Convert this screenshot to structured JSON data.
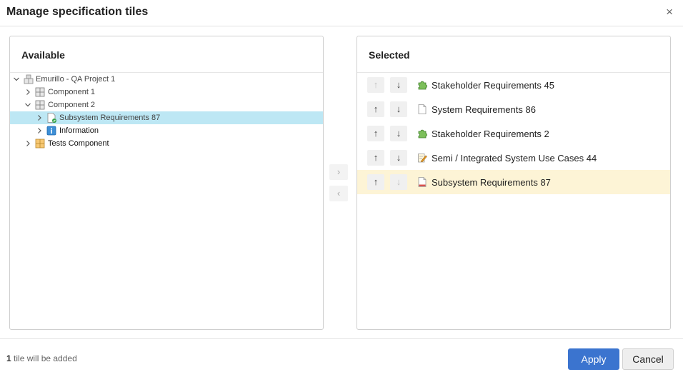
{
  "dialog": {
    "title": "Manage specification tiles",
    "close_glyph": "×"
  },
  "available": {
    "title": "Available",
    "tree": [
      {
        "label": "Emurillo - QA Project 1",
        "icon": "project-icon",
        "expanded": true
      },
      {
        "label": "Component 1",
        "icon": "component-icon",
        "expanded": false
      },
      {
        "label": "Component 2",
        "icon": "component-icon",
        "expanded": true
      },
      {
        "label": "Subsystem Requirements 87",
        "icon": "document-approved-icon",
        "expanded": false,
        "selected": true
      },
      {
        "label": "Information",
        "icon": "info-icon",
        "expanded": false
      },
      {
        "label": "Tests Component",
        "icon": "test-component-icon",
        "expanded": false
      }
    ]
  },
  "transfer": {
    "add_glyph": "›",
    "remove_glyph": "‹"
  },
  "selected": {
    "title": "Selected",
    "up_glyph": "↑",
    "down_glyph": "↓",
    "items": [
      {
        "label": "Stakeholder Requirements 45",
        "icon": "puzzle-icon",
        "up_disabled": true,
        "down_disabled": false
      },
      {
        "label": "System Requirements 86",
        "icon": "blank-document-icon",
        "up_disabled": false,
        "down_disabled": false
      },
      {
        "label": "Stakeholder Requirements 2",
        "icon": "puzzle-icon",
        "up_disabled": false,
        "down_disabled": false
      },
      {
        "label": "Semi / Integrated System Use Cases 44",
        "icon": "edit-document-icon",
        "up_disabled": false,
        "down_disabled": false
      },
      {
        "label": "Subsystem Requirements 87",
        "icon": "document-red-icon",
        "up_disabled": false,
        "down_disabled": true,
        "highlighted": true
      }
    ]
  },
  "footer": {
    "count": "1",
    "status_text": " tile will be added",
    "apply_label": "Apply",
    "cancel_label": "Cancel"
  },
  "colors": {
    "primary": "#3b74cf",
    "tree_selection": "#bde7f4",
    "new_item_highlight": "#fdf4d6"
  }
}
